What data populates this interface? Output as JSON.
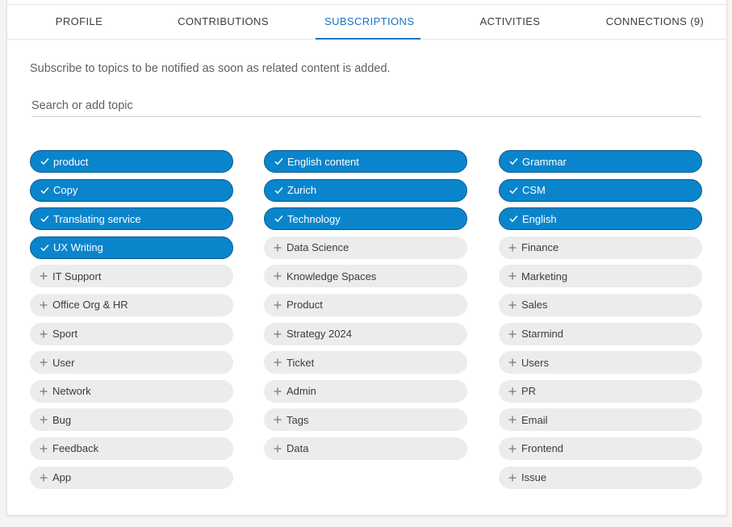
{
  "tabs": [
    {
      "label": "PROFILE",
      "active": false
    },
    {
      "label": "CONTRIBUTIONS",
      "active": false
    },
    {
      "label": "SUBSCRIPTIONS",
      "active": true
    },
    {
      "label": "ACTIVITIES",
      "active": false
    },
    {
      "label": "CONNECTIONS (9)",
      "active": false
    }
  ],
  "intro_text": "Subscribe to topics to be notified as soon as related content is added.",
  "search": {
    "placeholder": "Search or add topic",
    "value": ""
  },
  "colors": {
    "accent": "#1a73c8",
    "chip_on": "#0a85cc",
    "chip_off": "#ececec"
  },
  "icons": {
    "subscribed": "check-icon",
    "unsubscribed": "plus-icon"
  },
  "topic_columns": [
    [
      {
        "label": "product",
        "subscribed": true
      },
      {
        "label": "Copy",
        "subscribed": true
      },
      {
        "label": "Translating service",
        "subscribed": true
      },
      {
        "label": "UX Writing",
        "subscribed": true
      },
      {
        "label": "IT Support",
        "subscribed": false
      },
      {
        "label": "Office Org & HR",
        "subscribed": false
      },
      {
        "label": "Sport",
        "subscribed": false
      },
      {
        "label": "User",
        "subscribed": false
      },
      {
        "label": "Network",
        "subscribed": false
      },
      {
        "label": "Bug",
        "subscribed": false
      },
      {
        "label": "Feedback",
        "subscribed": false
      },
      {
        "label": "App",
        "subscribed": false
      }
    ],
    [
      {
        "label": "English content",
        "subscribed": true
      },
      {
        "label": "Zurich",
        "subscribed": true
      },
      {
        "label": "Technology",
        "subscribed": true
      },
      {
        "label": "Data Science",
        "subscribed": false
      },
      {
        "label": "Knowledge Spaces",
        "subscribed": false
      },
      {
        "label": "Product",
        "subscribed": false
      },
      {
        "label": "Strategy 2024",
        "subscribed": false
      },
      {
        "label": "Ticket",
        "subscribed": false
      },
      {
        "label": "Admin",
        "subscribed": false
      },
      {
        "label": "Tags",
        "subscribed": false
      },
      {
        "label": "Data",
        "subscribed": false
      }
    ],
    [
      {
        "label": "Grammar",
        "subscribed": true
      },
      {
        "label": "CSM",
        "subscribed": true
      },
      {
        "label": "English",
        "subscribed": true
      },
      {
        "label": "Finance",
        "subscribed": false
      },
      {
        "label": "Marketing",
        "subscribed": false
      },
      {
        "label": "Sales",
        "subscribed": false
      },
      {
        "label": "Starmind",
        "subscribed": false
      },
      {
        "label": "Users",
        "subscribed": false
      },
      {
        "label": "PR",
        "subscribed": false
      },
      {
        "label": "Email",
        "subscribed": false
      },
      {
        "label": "Frontend",
        "subscribed": false
      },
      {
        "label": "Issue",
        "subscribed": false
      }
    ]
  ]
}
